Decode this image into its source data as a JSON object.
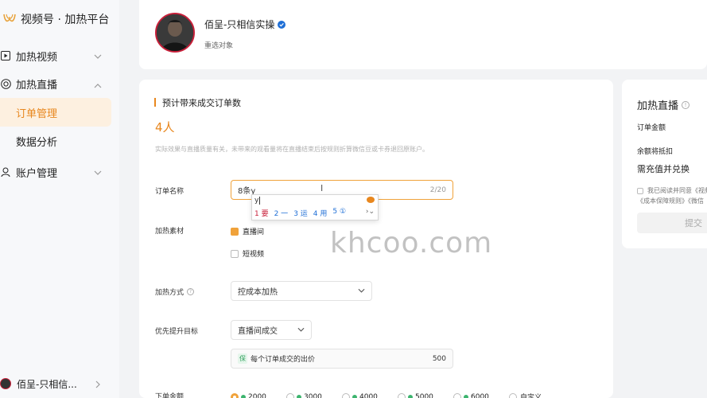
{
  "brand": {
    "title": "视频号 · 加热平台"
  },
  "sidebar": {
    "items": [
      {
        "label": "加热视频"
      },
      {
        "label": "加热直播"
      },
      {
        "label": "订单管理"
      },
      {
        "label": "数据分析"
      },
      {
        "label": "账户管理"
      }
    ],
    "user_name": "佰呈-只相信..."
  },
  "profile": {
    "name": "佰呈-只相信实操",
    "reselect": "重选对象"
  },
  "estimate": {
    "title": "预计带来成交订单数",
    "value": "4人",
    "note": "实际效果与直播质量有关，未带来的观看量将在直播结束后按规则折算微信豆或卡券退回原账户。"
  },
  "form": {
    "order_name_label": "订单名称",
    "order_name_value": "8条y",
    "order_name_count": "2/20",
    "ime": {
      "input": "y",
      "candidates": [
        "1 要",
        "2 一",
        "3 运",
        "4 用",
        "5 ①"
      ]
    },
    "material_label": "加热素材",
    "material_options": [
      "直播间",
      "短视频"
    ],
    "method_label": "加热方式",
    "method_value": "控成本加热",
    "target_label": "优先提升目标",
    "target_value": "直播间成交",
    "bid_badge": "保",
    "bid_label": "每个订单成交的出价",
    "bid_value": "500",
    "amount_label": "下单金额",
    "amounts": [
      "2000",
      "3000",
      "4000",
      "5000",
      "6000",
      "自定义"
    ]
  },
  "right_panel": {
    "title": "加热直播",
    "order_amount": "订单金额",
    "balance": "余额将抵扣",
    "need_recharge": "需充值并兑换",
    "agree_text": "我已阅读并同意《视频",
    "agree_text2": "《成本保障规则》《微信",
    "submit": "提交"
  },
  "watermark": "khcoo.com",
  "colors": {
    "accent": "#e8871e",
    "verified": "#1f6fd6",
    "avatar_ring": "#c8203a"
  }
}
